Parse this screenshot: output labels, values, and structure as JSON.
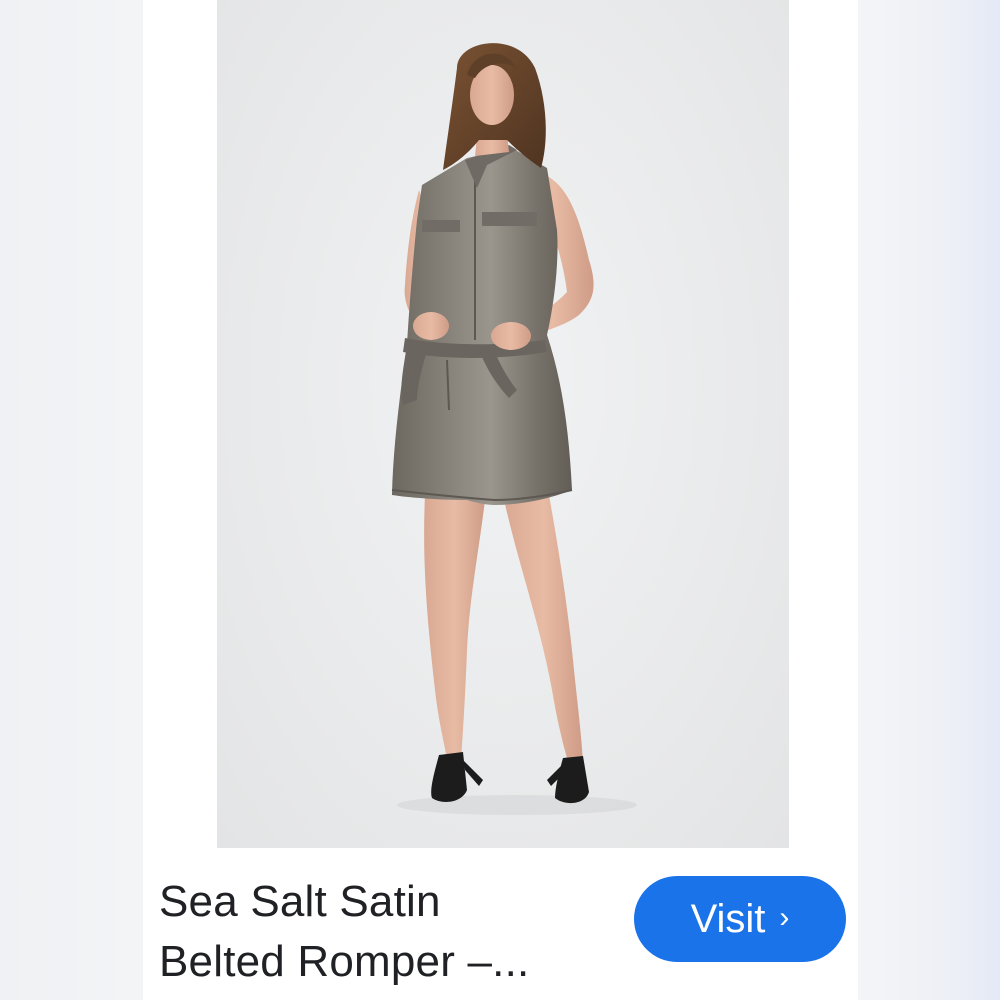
{
  "product": {
    "title_line1": "Sea Salt Satin",
    "title_line2": "Belted Romper –...",
    "image_description": "Model wearing a sleeveless grey satin belted romper with black strappy heels"
  },
  "visit_button": {
    "label": "Visit",
    "icon": "chevron-right-icon",
    "chevron": "›",
    "color": "#1a73e8"
  },
  "colors": {
    "romper": "#7a756e",
    "background": "#e9eaeb"
  }
}
